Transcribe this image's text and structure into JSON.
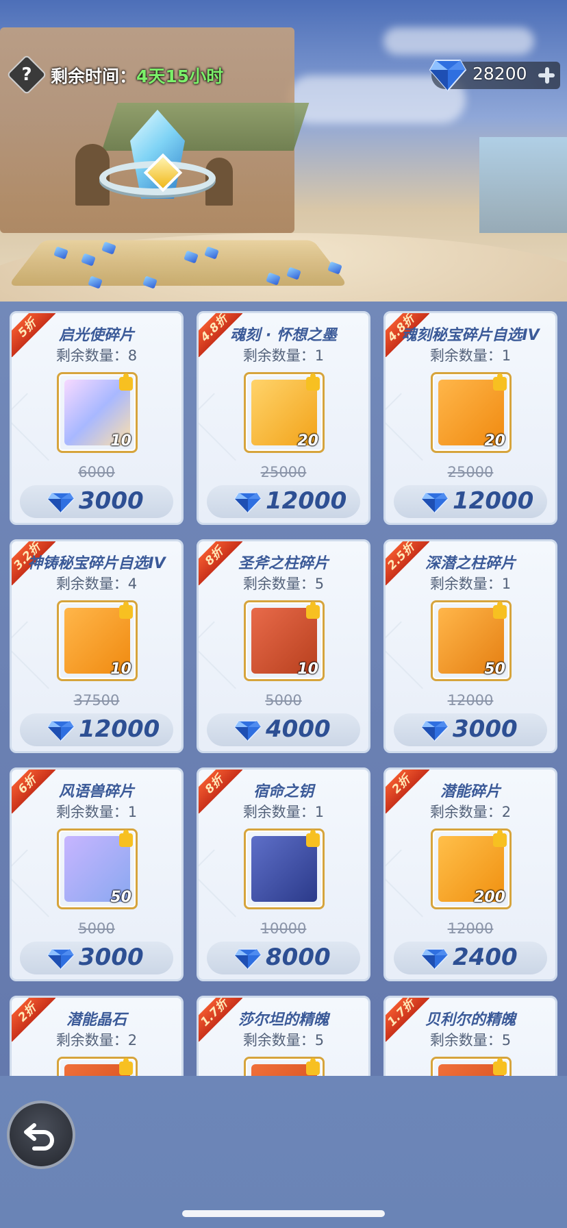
{
  "header": {
    "help_glyph": "?",
    "timer_label": "剩余时间：",
    "timer_value": "4天15小时",
    "diamond_balance": "28200"
  },
  "colors": {
    "ribbon": "#d93a1f",
    "price_text": "#2d4f93",
    "timer_value": "#7cf06a"
  },
  "items": [
    {
      "discount": "5折",
      "name": "启光使碎片",
      "stock": "剩余数量：8",
      "count": "10",
      "original_price": "6000",
      "price": "3000",
      "icon": "fairy-creature-icon"
    },
    {
      "discount": "4.8折",
      "name": "魂刻 · 怀想之墨",
      "stock": "剩余数量：1",
      "count": "20",
      "original_price": "25000",
      "price": "12000",
      "icon": "ink-bottle-icon"
    },
    {
      "discount": "4.8折",
      "name": "魂刻秘宝碎片自选IV",
      "stock": "剩余数量：1",
      "count": "20",
      "original_price": "25000",
      "price": "12000",
      "icon": "treasure-pedestal-icon"
    },
    {
      "discount": "3.2折",
      "name": "神铸秘宝碎片自选IV",
      "stock": "剩余数量：4",
      "count": "10",
      "original_price": "37500",
      "price": "12000",
      "icon": "treasure-pedestal-icon"
    },
    {
      "discount": "8折",
      "name": "圣斧之柱碎片",
      "stock": "剩余数量：5",
      "count": "10",
      "original_price": "5000",
      "price": "4000",
      "icon": "axe-pillar-icon"
    },
    {
      "discount": "2.5折",
      "name": "深潜之柱碎片",
      "stock": "剩余数量：1",
      "count": "50",
      "original_price": "12000",
      "price": "3000",
      "icon": "deep-pillar-icon"
    },
    {
      "discount": "6折",
      "name": "风语兽碎片",
      "stock": "剩余数量：1",
      "count": "50",
      "original_price": "5000",
      "price": "3000",
      "icon": "white-beast-icon"
    },
    {
      "discount": "8折",
      "name": "宿命之钥",
      "stock": "剩余数量：1",
      "count": "",
      "original_price": "10000",
      "price": "8000",
      "icon": "key-icon"
    },
    {
      "discount": "2折",
      "name": "潜能碎片",
      "stock": "剩余数量：2",
      "count": "200",
      "original_price": "12000",
      "price": "2400",
      "icon": "crystal-shard-icon"
    },
    {
      "discount": "2折",
      "name": "潜能晶石",
      "stock": "剩余数量：2",
      "count": "",
      "original_price": "",
      "price": "",
      "icon": "crystal-icon"
    },
    {
      "discount": "1.7折",
      "name": "莎尔坦的精魄",
      "stock": "剩余数量：5",
      "count": "",
      "original_price": "",
      "price": "",
      "icon": "spirit-icon"
    },
    {
      "discount": "1.7折",
      "name": "贝利尔的精魄",
      "stock": "剩余数量：5",
      "count": "",
      "original_price": "",
      "price": "",
      "icon": "spirit-icon"
    }
  ]
}
